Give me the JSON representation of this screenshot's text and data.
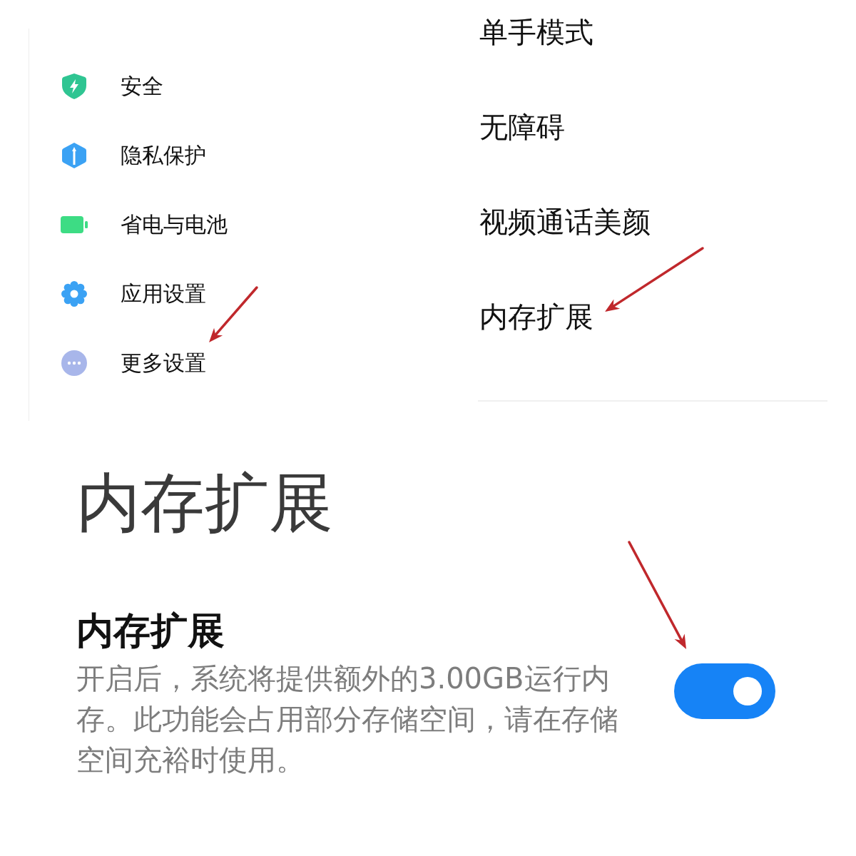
{
  "settings_menu": {
    "items": [
      {
        "label": "安全"
      },
      {
        "label": "隐私保护"
      },
      {
        "label": "省电与电池"
      },
      {
        "label": "应用设置"
      },
      {
        "label": "更多设置"
      }
    ]
  },
  "more_settings": {
    "items": [
      {
        "label": "单手模式"
      },
      {
        "label": "无障碍"
      },
      {
        "label": "视频通话美颜"
      },
      {
        "label": "内存扩展"
      }
    ]
  },
  "memory_extension": {
    "title": "内存扩展",
    "setting": {
      "title": "内存扩展",
      "description": "开启后，系统将提供额外的3.00GB运行内存。此功能会占用部分存储空间，请在存储空间充裕时使用。",
      "on": true
    }
  }
}
